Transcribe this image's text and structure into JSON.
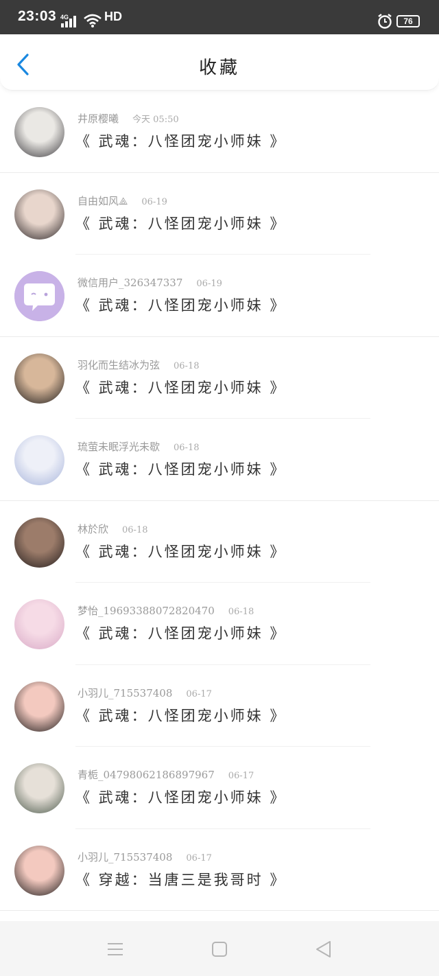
{
  "status": {
    "time": "23:03",
    "network": "4G",
    "hd": "HD",
    "battery": "76"
  },
  "header": {
    "title": "收藏"
  },
  "items": [
    {
      "user": "井原樱曦",
      "date": "今天 05:50",
      "book": "《 武魂：八怪团宠小师妹 》",
      "avatar": [
        "#eae8e4",
        "#3c3a3e"
      ]
    },
    {
      "user": "自由如风⟁",
      "date": "06-19",
      "book": "《 武魂：八怪团宠小师妹 》",
      "avatar": [
        "#e8d6cc",
        "#2a2426"
      ]
    },
    {
      "user": "微信用户_326347337",
      "date": "06-19",
      "book": "《 武魂：八怪团宠小师妹 》",
      "avatar": [
        "#c9b3e6",
        "#b29ad6"
      ]
    },
    {
      "user": "羽化而生结冰为弦",
      "date": "06-18",
      "book": "《 武魂：八怪团宠小师妹 》",
      "avatar": [
        "#d7b79a",
        "#1e1c1c"
      ]
    },
    {
      "user": "琉萤未眠浮光未歇",
      "date": "06-18",
      "book": "《 武魂：八怪团宠小师妹 》",
      "avatar": [
        "#eef0f8",
        "#a7b4db"
      ]
    },
    {
      "user": "林於欣",
      "date": "06-18",
      "book": "《 武魂：八怪团宠小师妹 》",
      "avatar": [
        "#9c7c6a",
        "#231d1d"
      ]
    },
    {
      "user": "梦怡_19693388072820470",
      "date": "06-18",
      "book": "《 武魂：八怪团宠小师妹 》",
      "avatar": [
        "#f6dbe6",
        "#d8a9c6"
      ]
    },
    {
      "user": "小羽儿_715537408",
      "date": "06-17",
      "book": "《 武魂：八怪团宠小师妹 》",
      "avatar": [
        "#f3c9bf",
        "#1c1a1a"
      ]
    },
    {
      "user": "青栀_04798062186897967",
      "date": "06-17",
      "book": "《 武魂：八怪团宠小师妹 》",
      "avatar": [
        "#e6e0d8",
        "#4c5a4c"
      ]
    },
    {
      "user": "小羽儿_715537408",
      "date": "06-17",
      "book": "《 穿越：当唐三是我哥时 》",
      "avatar": [
        "#f3c9bf",
        "#1c1a1a"
      ]
    }
  ],
  "colors": {
    "accent": "#1a88e0",
    "status_bar": "#3a3a3a",
    "nav_bar": "#f5f5f5"
  }
}
